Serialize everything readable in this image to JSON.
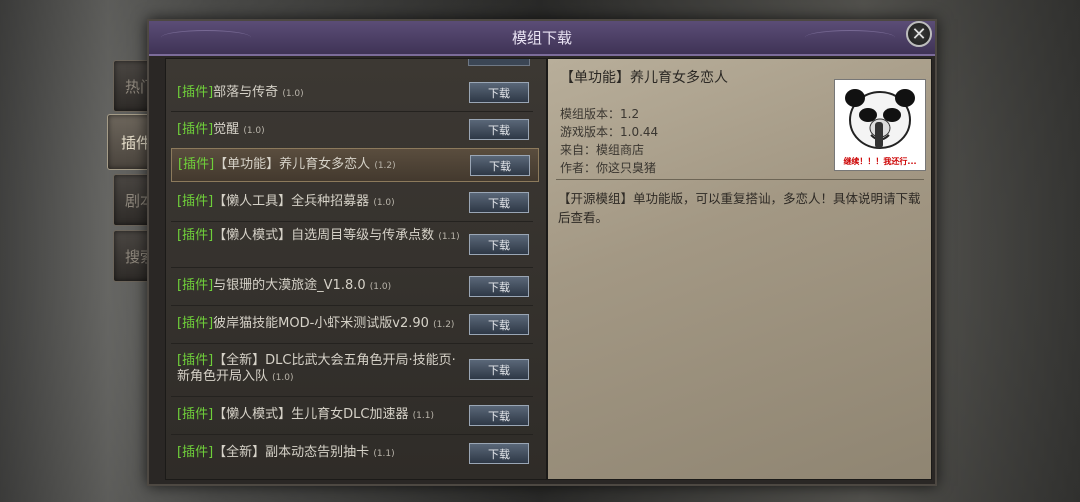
{
  "window": {
    "title": "模组下载",
    "close_glyph": "✕"
  },
  "side_tabs": [
    {
      "label": "热门"
    },
    {
      "label": "插件"
    },
    {
      "label": "剧本"
    },
    {
      "label": "搜索"
    }
  ],
  "download_label": "下载",
  "mods": [
    {
      "tag": "[插件]",
      "name": "部落与传奇",
      "version": "(1.0)"
    },
    {
      "tag": "[插件]",
      "name": "觉醒",
      "version": "(1.0)"
    },
    {
      "tag": "[插件]",
      "name": "【单功能】养儿育女多恋人",
      "version": "(1.2)"
    },
    {
      "tag": "[插件]",
      "name": "【懒人工具】全兵种招募器",
      "version": "(1.0)"
    },
    {
      "tag": "[插件]",
      "name": "【懒人模式】自选周目等级与传承点数",
      "version": "(1.1)"
    },
    {
      "tag": "[插件]",
      "name": "与银珊的大漠旅途_V1.8.0",
      "version": "(1.0)"
    },
    {
      "tag": "[插件]",
      "name": "彼岸猫技能MOD-小虾米测试版v2.90",
      "version": "(1.2)"
    },
    {
      "tag": "[插件]",
      "name": "【全新】DLC比武大会五角色开局·技能页·新角色开局入队",
      "version": "(1.0)"
    },
    {
      "tag": "[插件]",
      "name": "【懒人模式】生儿育女DLC加速器",
      "version": "(1.1)"
    },
    {
      "tag": "[插件]",
      "name": "【全新】副本动态告别抽卡",
      "version": "(1.1)"
    }
  ],
  "detail": {
    "title": "【单功能】养儿育女多恋人",
    "mod_version": "模组版本：1.2",
    "game_version": "游戏版本：1.0.44",
    "source": "来自：模组商店",
    "author": "作者：你这只臭猪",
    "description": "【开源模组】单功能版，可以重复搭讪，多恋人！具体说明请下载后查看。",
    "thumbnail_caption": "继续！！！我还行..."
  }
}
